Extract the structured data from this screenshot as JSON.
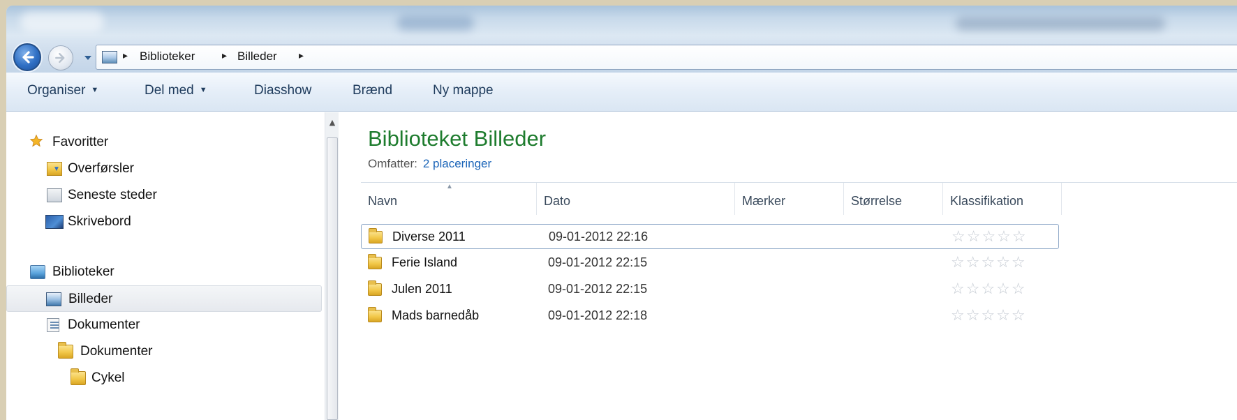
{
  "address_bar": {
    "breadcrumbs": [
      "Biblioteker",
      "Billeder"
    ]
  },
  "commands": {
    "organise": "Organiser",
    "share": "Del med",
    "slideshow": "Diasshow",
    "burn": "Brænd",
    "new_folder": "Ny mappe"
  },
  "nav_pane": {
    "favorites_header": "Favoritter",
    "favorites": [
      "Overførsler",
      "Seneste steder",
      "Skrivebord"
    ],
    "libraries_header": "Biblioteker",
    "libraries": [
      "Billeder",
      "Dokumenter"
    ],
    "sub_documents": "Dokumenter",
    "sub_cycle": "Cykel"
  },
  "library": {
    "title": "Biblioteket Billeder",
    "includes_label": "Omfatter:",
    "includes_link": "2 placeringer"
  },
  "columns": {
    "name": "Navn",
    "date": "Dato",
    "tags": "Mærker",
    "size": "Størrelse",
    "rating": "Klassifikation"
  },
  "files": [
    {
      "name": "Diverse 2011",
      "date": "09-01-2012 22:16",
      "rating": 0
    },
    {
      "name": "Ferie Island",
      "date": "09-01-2012 22:15",
      "rating": 0
    },
    {
      "name": "Julen 2011",
      "date": "09-01-2012 22:15",
      "rating": 0
    },
    {
      "name": "Mads barnedåb",
      "date": "09-01-2012 22:18",
      "rating": 0
    }
  ],
  "icons": {
    "back": "back-arrow-icon",
    "forward": "forward-arrow-icon",
    "favorites": "star-icon",
    "folder": "folder-icon"
  },
  "colors": {
    "library_title": "#1e7c2e",
    "link": "#1a64b8",
    "command_text": "#1e3b5c"
  }
}
